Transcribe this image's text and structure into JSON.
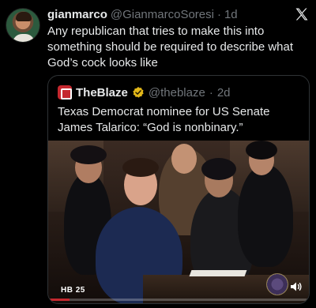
{
  "tweet": {
    "display_name": "gianmarco",
    "handle": "@GianmarcoSoresi",
    "separator": "·",
    "timestamp": "1d",
    "text": "Any republican that tries to make this into something should be required to describe what God’s cock looks like"
  },
  "quote": {
    "display_name": "TheBlaze",
    "handle": "@theblaze",
    "separator": "·",
    "timestamp": "2d",
    "text": "Texas Democrat nominee for US Senate James Talarico: “God is nonbinary.”"
  },
  "video": {
    "badge": "HB 25",
    "progress": 0.08,
    "accent_color": "#c5282f"
  },
  "icons": {
    "platform": "x-logo-icon",
    "verified": "gold-verified-icon",
    "volume": "volume-icon",
    "outlet_logo": "theblaze-logo-icon"
  }
}
